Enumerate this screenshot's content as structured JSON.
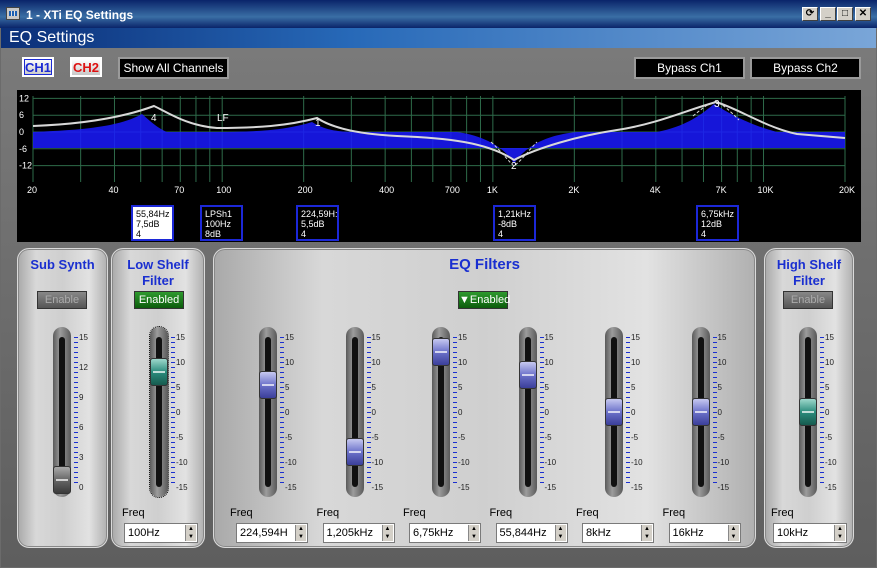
{
  "window": {
    "title": "1 - XTi EQ Settings"
  },
  "section": {
    "title": "EQ Settings"
  },
  "toolbar": {
    "ch1": "CH1",
    "ch2": "CH2",
    "show_all": "Show All Channels",
    "bypass_ch1": "Bypass Ch1",
    "bypass_ch2": "Bypass Ch2"
  },
  "graph": {
    "y_ticks": [
      "12",
      "6",
      "0",
      "-6",
      "-12"
    ],
    "x_ticks": [
      "20",
      "40",
      "70",
      "100",
      "200",
      "400",
      "700",
      "1K",
      "2K",
      "4K",
      "7K",
      "10K",
      "20K"
    ],
    "curve_labels": [
      "4",
      "LF",
      "1",
      "2",
      "3"
    ],
    "markers": [
      {
        "lines": [
          "55,84Hz",
          "7,5dB",
          "4"
        ],
        "selected": true
      },
      {
        "lines": [
          "LPSh1",
          "100Hz",
          "8dB"
        ],
        "selected": false
      },
      {
        "lines": [
          "224,59H:",
          "5,5dB",
          "4"
        ],
        "selected": false
      },
      {
        "lines": [
          "1,21kHz",
          "-8dB",
          "4"
        ],
        "selected": false
      },
      {
        "lines": [
          "6,75kHz",
          "12dB",
          "4"
        ],
        "selected": false
      }
    ]
  },
  "sub_synth": {
    "title": "Sub Synth",
    "enable": "Enable",
    "scale": [
      "15",
      "12",
      "9",
      "6",
      "3",
      "0"
    ],
    "value_fraction": 0.05
  },
  "low_shelf": {
    "title": "Low Shelf Filter",
    "enable": "Enabled",
    "freq_label": "Freq",
    "freq": "100Hz",
    "gain_db": 8
  },
  "eq_filters": {
    "title": "EQ Filters",
    "enable": "Enabled",
    "bands": [
      {
        "freq_label": "Freq",
        "freq": "224,594H",
        "gain_db": 5.5
      },
      {
        "freq_label": "Freq",
        "freq": "1,205kHz",
        "gain_db": -8
      },
      {
        "freq_label": "Freq",
        "freq": "6,75kHz",
        "gain_db": 12
      },
      {
        "freq_label": "Freq",
        "freq": "55,844Hz",
        "gain_db": 7.5
      },
      {
        "freq_label": "Freq",
        "freq": "8kHz",
        "gain_db": 0
      },
      {
        "freq_label": "Freq",
        "freq": "16kHz",
        "gain_db": 0
      }
    ]
  },
  "high_shelf": {
    "title": "High Shelf Filter",
    "enable": "Enable",
    "freq_label": "Freq",
    "freq": "10kHz",
    "gain_db": 0
  },
  "gain_scale": [
    "15",
    "10",
    "5",
    "0",
    "-5",
    "-10",
    "-15"
  ]
}
